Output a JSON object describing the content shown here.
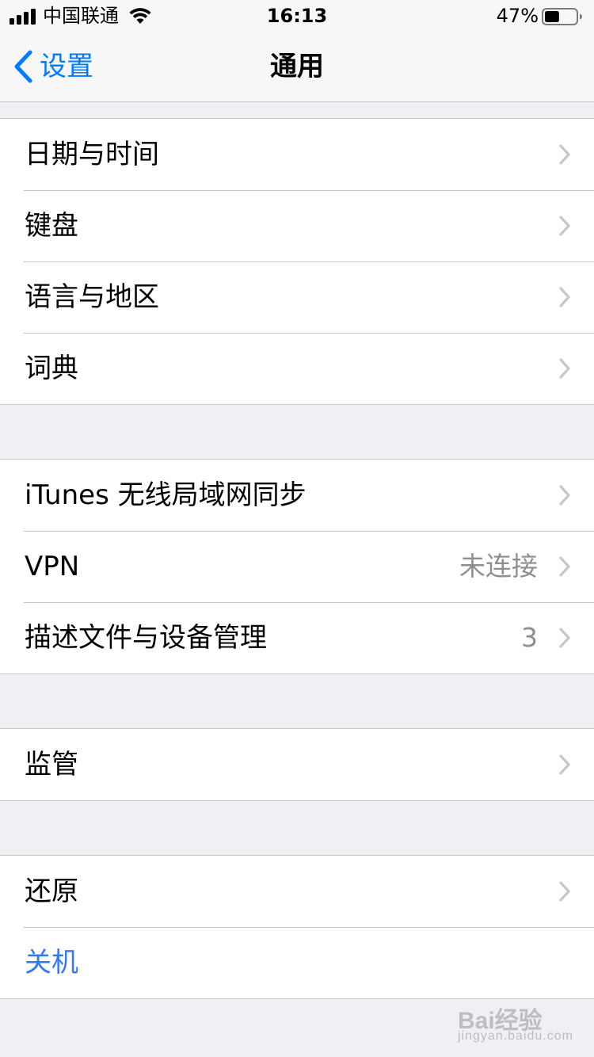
{
  "status_bar": {
    "carrier": "中国联通",
    "time": "16:13",
    "battery_percent": "47%",
    "battery_level": 0.47,
    "signal_bars": 4,
    "icons": [
      "signal-icon",
      "wifi-icon",
      "battery-icon"
    ]
  },
  "nav": {
    "back_label": "设置",
    "title": "通用",
    "accent_color": "#007aff"
  },
  "groups": [
    {
      "rows": [
        {
          "label": "日期与时间"
        },
        {
          "label": "键盘"
        },
        {
          "label": "语言与地区"
        },
        {
          "label": "词典"
        }
      ]
    },
    {
      "rows": [
        {
          "label": "iTunes 无线局域网同步"
        },
        {
          "label": "VPN",
          "value": "未连接"
        },
        {
          "label": "描述文件与设备管理",
          "value": "3"
        }
      ]
    },
    {
      "rows": [
        {
          "label": "监管"
        }
      ]
    },
    {
      "rows": [
        {
          "label": "还原"
        },
        {
          "label": "关机"
        }
      ]
    }
  ],
  "watermark": {
    "brand": "Bai经验",
    "url": "jingyan.baidu.com"
  }
}
